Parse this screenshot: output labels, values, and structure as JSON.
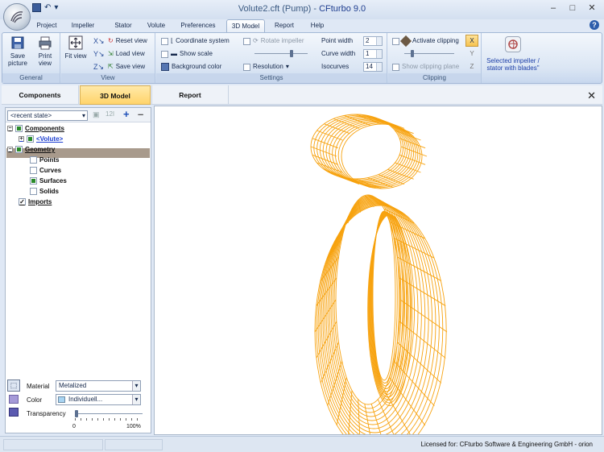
{
  "window": {
    "title_prefix": "Volute2.cft (Pump) - ",
    "title_app": "CFturbo 9.0"
  },
  "tabs": [
    "Project",
    "Impeller",
    "Stator",
    "Volute",
    "Preferences",
    "3D Model",
    "Report",
    "Help"
  ],
  "active_tab": "3D Model",
  "ribbon": {
    "general": {
      "label": "General",
      "save_picture": "Save picture",
      "print_view": "Print view"
    },
    "view": {
      "label": "View",
      "fit_view": "Fit view",
      "reset_view": "Reset view",
      "load_view": "Load view",
      "save_view": "Save view"
    },
    "settings": {
      "label": "Settings",
      "coordinate_system": "Coordinate system",
      "rotate_impeller": "Rotate impeller",
      "show_scale": "Show scale",
      "background_color": "Background color",
      "resolution": "Resolution",
      "point_width_label": "Point width",
      "point_width": "2",
      "curve_width_label": "Curve width",
      "curve_width": "1",
      "isocurves_label": "Isocurves",
      "isocurves": "14"
    },
    "clipping": {
      "label": "Clipping",
      "activate_clipping": "Activate clipping",
      "show_clipping_plane": "Show clipping plane"
    },
    "selected": {
      "line1": "Selected impeller /",
      "line2": "stator with blades\""
    }
  },
  "panel": {
    "components": "Components",
    "model3d": "3D Model",
    "report": "Report"
  },
  "state_combo": "<recent state>",
  "tree": {
    "components": "Components",
    "volute": "<Volute>",
    "geometry": "Geometry",
    "points": "Points",
    "curves": "Curves",
    "surfaces": "Surfaces",
    "solids": "Solids",
    "imports": "Imports"
  },
  "props": {
    "material_label": "Material",
    "material_value": "Metalized",
    "color_label": "Color",
    "color_value": "Individuell...",
    "color_swatch": "#a8d4f2",
    "transparency_label": "Transparency",
    "transparency_min": "0",
    "transparency_max": "100%",
    "transparency_level": 0
  },
  "status": {
    "license": "Licensed for: CFturbo Software & Engineering GmbH - orion"
  },
  "colors": {
    "wireframe": "#f7a20e",
    "selection": "#a89a8c"
  }
}
